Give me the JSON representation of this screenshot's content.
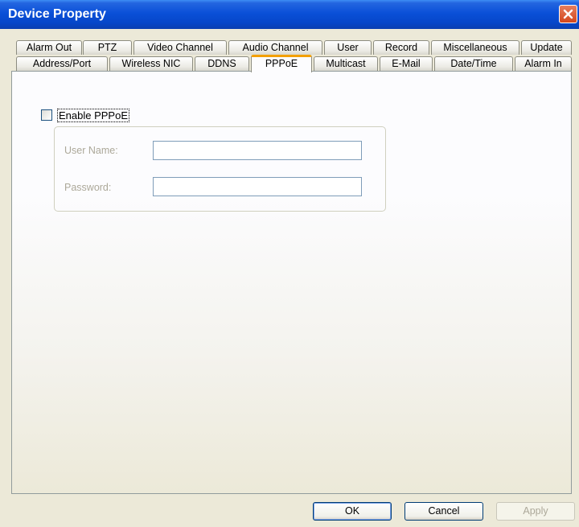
{
  "window": {
    "title": "Device Property",
    "close_icon": "close-icon"
  },
  "tabs": {
    "row1": [
      "Alarm Out",
      "PTZ",
      "Video Channel",
      "Audio Channel",
      "User",
      "Record",
      "Miscellaneous",
      "Update"
    ],
    "row2": [
      "Address/Port",
      "Wireless NIC",
      "DDNS",
      "PPPoE",
      "Multicast",
      "E-Mail",
      "Date/Time",
      "Alarm In"
    ],
    "active": "PPPoE"
  },
  "pppoe": {
    "enable_label": "Enable PPPoE",
    "enabled": false,
    "username_label": "User Name:",
    "username_value": "",
    "password_label": "Password:",
    "password_value": ""
  },
  "buttons": {
    "ok": "OK",
    "cancel": "Cancel",
    "apply": "Apply"
  },
  "colors": {
    "titlebar": "#0a50d8",
    "active_tab_accent": "#f3a000",
    "close_button": "#d4461c"
  }
}
